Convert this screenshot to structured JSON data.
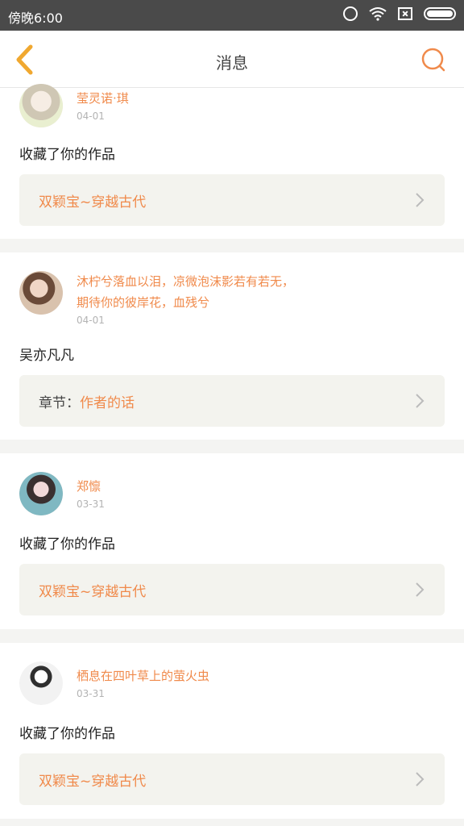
{
  "status": {
    "time": "傍晚6:00"
  },
  "header": {
    "title": "消息"
  },
  "colors": {
    "accent": "#f08a4b",
    "ref_bg": "#f3f3ee"
  },
  "messages": [
    {
      "name": "莹灵诺·琪",
      "date": "04-01",
      "text": "收藏了你的作品",
      "ref_prefix": "",
      "ref": "双颖宝~穿越古代"
    },
    {
      "name": "沐柠兮落血以泪，凉微泡沫影若有若无，期待你的彼岸花，血残兮",
      "date": "04-01",
      "text": "吴亦凡凡",
      "ref_prefix": "章节：",
      "ref": "作者的话"
    },
    {
      "name": "郑懔",
      "date": "03-31",
      "text": "收藏了你的作品",
      "ref_prefix": "",
      "ref": "双颖宝~穿越古代"
    },
    {
      "name": "栖息在四叶草上的萤火虫",
      "date": "03-31",
      "text": "收藏了你的作品",
      "ref_prefix": "",
      "ref": "双颖宝~穿越古代"
    }
  ]
}
